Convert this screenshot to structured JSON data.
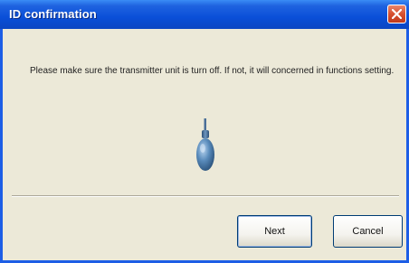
{
  "window": {
    "title": "ID confirmation",
    "close_icon": "close-icon"
  },
  "dialog": {
    "message": "Please make sure the transmitter unit is turn off. If not, it will concerned in functions setting.",
    "icon": "transmitter-device-icon"
  },
  "buttons": {
    "next_label": "Next",
    "cancel_label": "Cancel"
  },
  "colors": {
    "titlebar": "#0a4fd8",
    "dialog_background": "#ece9d8",
    "close_button": "#d64f2f",
    "device_body": "#3f6f9e"
  }
}
